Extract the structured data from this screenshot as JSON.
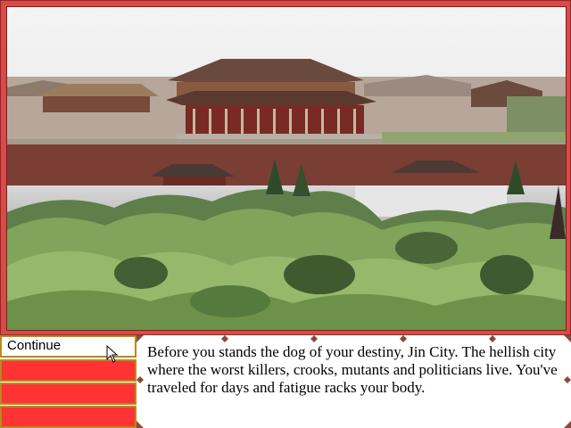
{
  "scene": {
    "icon": "forbidden-city-photo"
  },
  "menu": {
    "items": [
      {
        "label": "Continue",
        "active": true
      },
      {
        "label": "",
        "active": false
      },
      {
        "label": "",
        "active": false
      },
      {
        "label": "",
        "active": false
      }
    ]
  },
  "message": {
    "text": "Before you stands the dog of your destiny, Jin City. The hellish city where the worst killers, crooks, mutants and politicians live. You've traveled for days and fatigue racks your body."
  },
  "colors": {
    "frame": "#d94a4a",
    "menu_empty": "#ff3333",
    "menu_border": "#b88a1e"
  }
}
